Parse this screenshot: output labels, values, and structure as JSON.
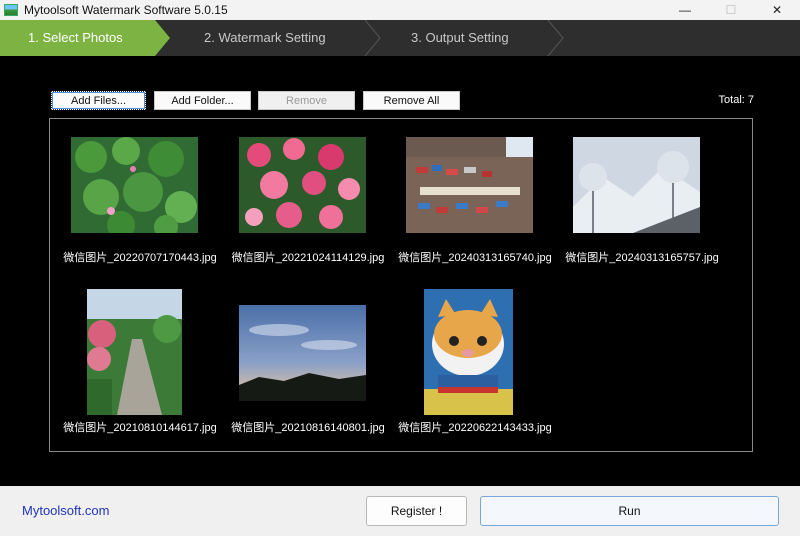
{
  "window": {
    "title": "Mytoolsoft Watermark Software 5.0.15",
    "minimize": "—",
    "maximize": "☐",
    "close": "✕"
  },
  "steps": [
    {
      "label": "1. Select Photos",
      "active": true
    },
    {
      "label": "2. Watermark Setting",
      "active": false
    },
    {
      "label": "3. Output Setting",
      "active": false
    }
  ],
  "toolbar": {
    "add_files": "Add Files...",
    "add_folder": "Add Folder...",
    "remove": "Remove",
    "remove_all": "Remove All",
    "total": "Total: 7"
  },
  "photos": [
    {
      "filename": "微信图片_20220707170443.jpg",
      "subject": "lotus-pond"
    },
    {
      "filename": "微信图片_20221024114129.jpg",
      "subject": "pink-flowers"
    },
    {
      "filename": "微信图片_20240313165740.jpg",
      "subject": "sign-wall"
    },
    {
      "filename": "微信图片_20240313165757.jpg",
      "subject": "snowy-mountain"
    },
    {
      "filename": "微信图片_20210810144617.jpg",
      "subject": "garden-path"
    },
    {
      "filename": "微信图片_20210816140801.jpg",
      "subject": "evening-sky"
    },
    {
      "filename": "微信图片_20220622143433.jpg",
      "subject": "cat"
    }
  ],
  "footer": {
    "brand": "Mytoolsoft.com",
    "register": "Register !",
    "run": "Run"
  },
  "colors": {
    "active_step": "#7cb342",
    "brand_link": "#2035b8"
  }
}
